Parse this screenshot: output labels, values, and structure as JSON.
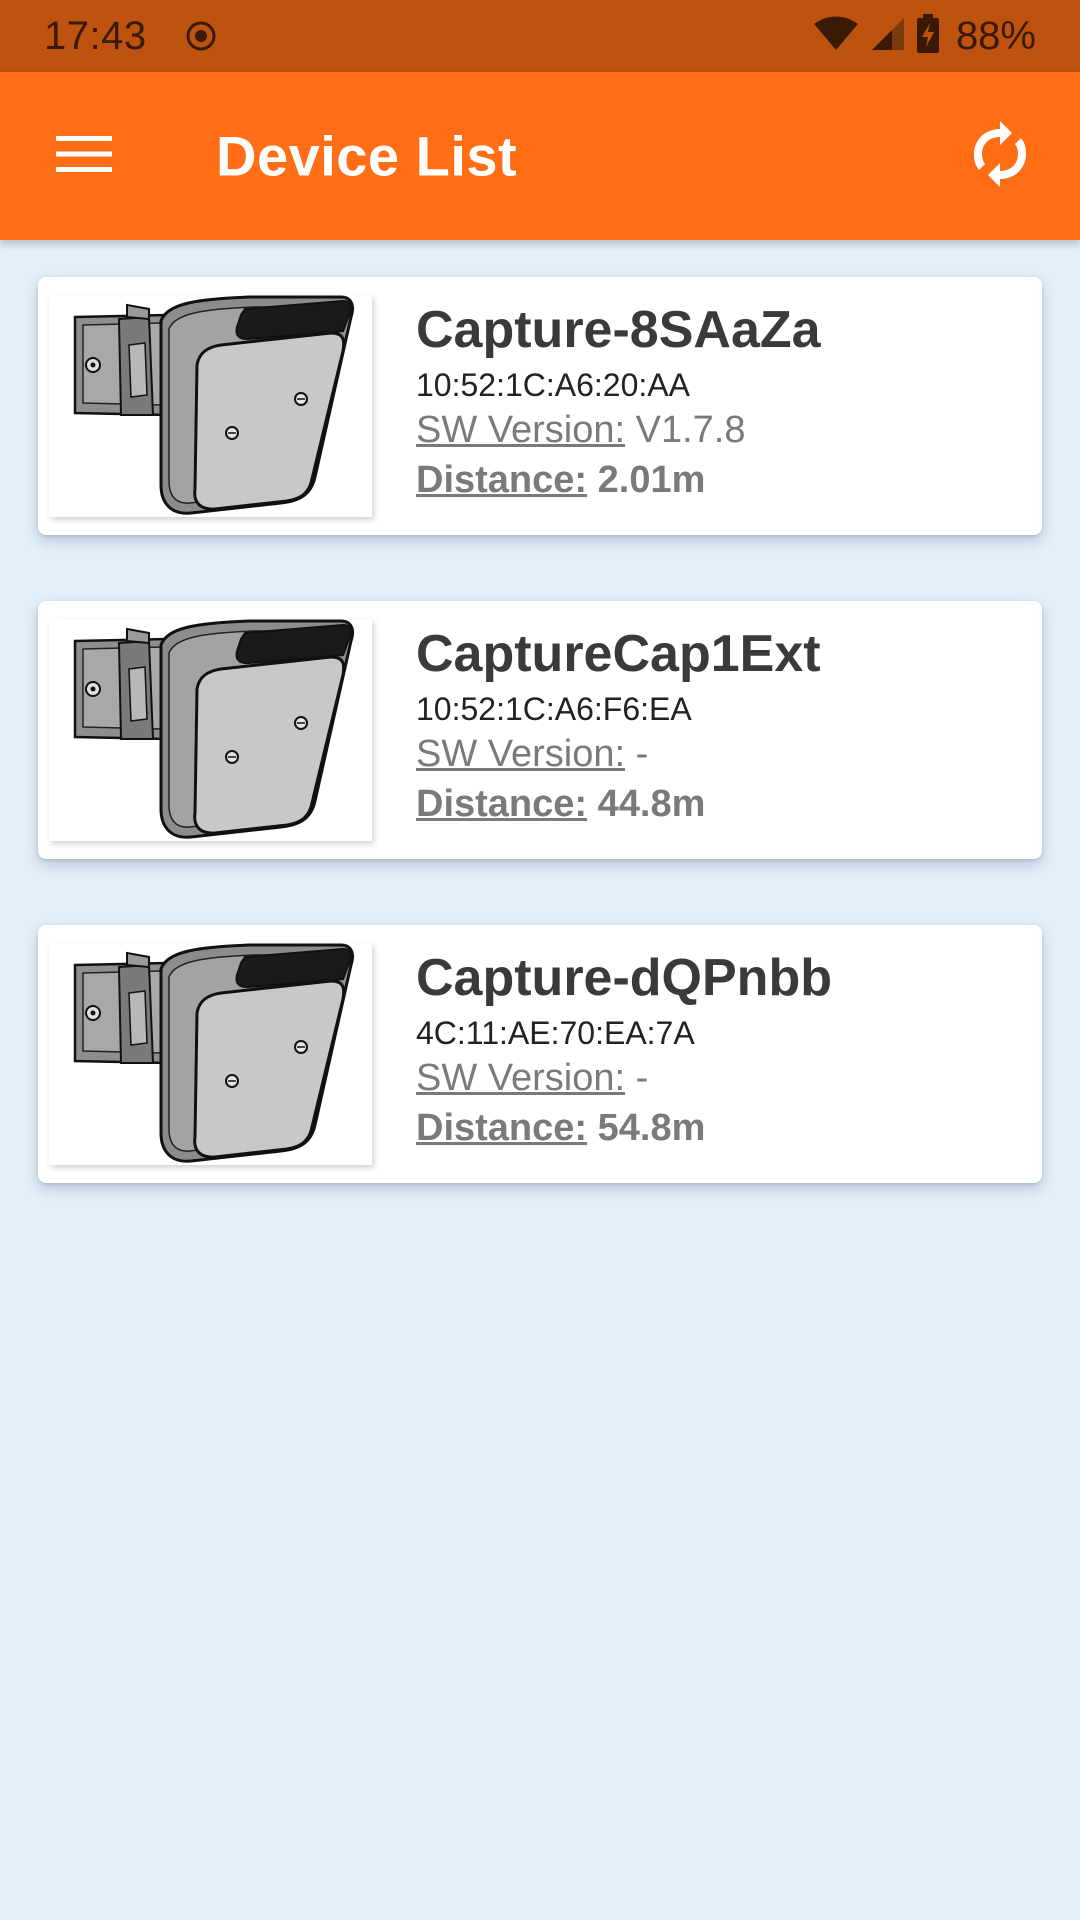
{
  "status_bar": {
    "time": "17:43",
    "battery": "88%",
    "icons": [
      "location-target-icon",
      "wifi-icon",
      "cell-signal-icon",
      "battery-charging-icon"
    ]
  },
  "app_bar": {
    "title": "Device List",
    "menu_icon": "hamburger-menu-icon",
    "refresh_icon": "refresh-icon",
    "background": "#FF6E14"
  },
  "devices": [
    {
      "name": "Capture-8SAaZa",
      "mac": "10:52:1C:A6:20:AA",
      "sw_label": "SW Version:",
      "sw_value": "V1.7.8",
      "distance_label": "Distance:",
      "distance_value": "2.01m"
    },
    {
      "name": "CaptureCap1Ext",
      "mac": "10:52:1C:A6:F6:EA",
      "sw_label": "SW Version:",
      "sw_value": "-",
      "distance_label": "Distance:",
      "distance_value": "44.8m"
    },
    {
      "name": "Capture-dQPnbb",
      "mac": "4C:11:AE:70:EA:7A",
      "sw_label": "SW Version:",
      "sw_value": "-",
      "distance_label": "Distance:",
      "distance_value": "54.8m"
    }
  ],
  "colors": {
    "status_bar": "#BE5310",
    "background": "#E3F0FB",
    "card": "#FFFFFF"
  }
}
